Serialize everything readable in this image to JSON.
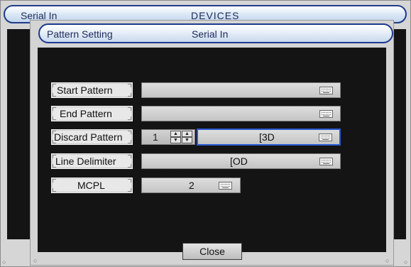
{
  "background_window": {
    "title_left": "Serial In",
    "title_center": "DEVICES"
  },
  "dialog": {
    "title_left": "Pattern Setting",
    "title_center": "Serial In",
    "rows": [
      {
        "label": "Start Pattern",
        "value": ""
      },
      {
        "label": "End Pattern",
        "value": ""
      },
      {
        "label": "Discard Pattern",
        "spin_value": "1",
        "value": "[3D"
      },
      {
        "label": "Line Delimiter",
        "value": "[OD"
      },
      {
        "label": "MCPL",
        "value": "2"
      }
    ],
    "close_label": "Close"
  },
  "colors": {
    "title_border": "#1c3a8c",
    "active_field_border": "#2a5ad0",
    "panel_background": "#141414"
  },
  "icons": [
    "keyboard-icon",
    "spin-up-icon",
    "spin-down-icon"
  ]
}
